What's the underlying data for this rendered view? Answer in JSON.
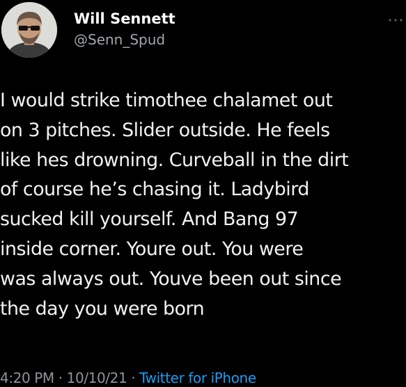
{
  "tweet": {
    "author": {
      "display_name": "Will Sennett",
      "handle": "@Senn_Spud",
      "avatar_icon": "profile-photo-sunglasses"
    },
    "more_icon": "ellipsis-icon",
    "text_lines": [
      "I would strike timothee chalamet out",
      "on 3 pitches. Slider outside. He feels",
      "like hes drowning. Curveball in the dirt",
      "of course he’s chasing it. Ladybird",
      "sucked kill yourself. And Bang 97",
      "inside corner. Youre out. You were",
      "was always out. Youve been out since",
      "the day you were born"
    ],
    "meta": {
      "time": "4:20 PM",
      "separator": " · ",
      "date": "10/10/21",
      "source": "Twitter for iPhone"
    }
  },
  "colors": {
    "background": "#000000",
    "text": "#f2f2f2",
    "secondary": "#8d949a",
    "link": "#1d9bf0"
  }
}
